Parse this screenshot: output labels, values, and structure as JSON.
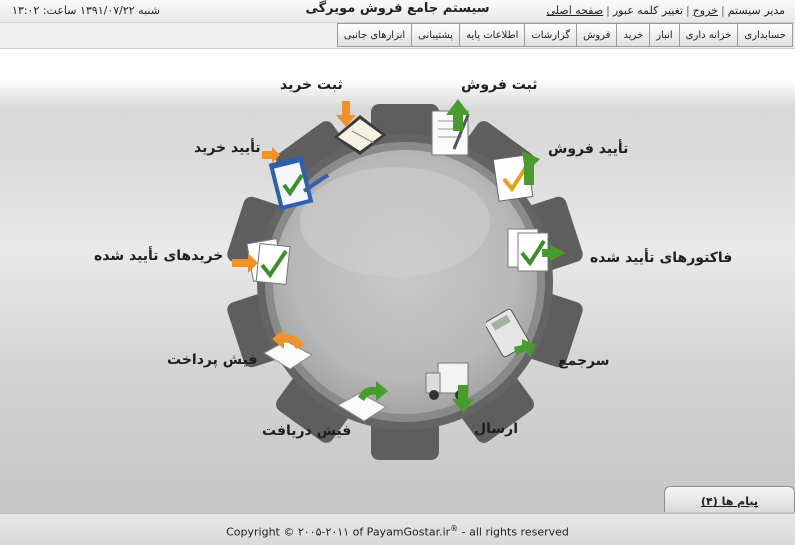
{
  "header": {
    "user": "مدیر سیستم",
    "logout": "خروج",
    "change_password": "تغییر کلمه عبور",
    "home": "صفحه اصلی",
    "title": "سیستم جامع فروش مویرگی",
    "datetime": "شنبه ۱۳۹۱/۰۷/۲۲ ساعت: ۱۳:۰۲"
  },
  "menu": [
    "حسابداری",
    "خزانه داری",
    "انبار",
    "خرید",
    "فروش",
    "گزارشات",
    "اطلاعات پایه",
    "پشتیبانی",
    "ابزارهای جانبی"
  ],
  "workflow": {
    "sale_register": "ثبت فروش",
    "sale_approve": "تأیید فروش",
    "approved_invoices": "فاکتورهای تأیید شده",
    "collection": "سرجمع",
    "shipping": "ارسال",
    "receipt": "فیش دریافت",
    "payment": "فیش پرداخت",
    "approved_purchases": "خریدهای تأیید شده",
    "purchase_approve": "تأیید خرید",
    "purchase_register": "ثبت خرید"
  },
  "messages": {
    "label": "پیام ها (۴)"
  },
  "footer": {
    "prefix": "Copyright © ۲۰۰۵-۲۰۱۱ of PayamGostar.ir",
    "registered": "®",
    "suffix": " - all rights reserved"
  },
  "colors": {
    "gear_dark": "#5a5a5a",
    "gear_face": "#bdbdbd",
    "arrow_green": "#4a9b2f",
    "arrow_orange": "#f0922b"
  },
  "icons": [
    "document-pen-icon",
    "document-check-icon",
    "invoices-check-icon",
    "calculator-icon",
    "truck-icon",
    "receipt-arrow-icon",
    "payment-arrow-icon",
    "documents-check-icon",
    "clipboard-check-icon",
    "notepad-arrow-icon"
  ]
}
